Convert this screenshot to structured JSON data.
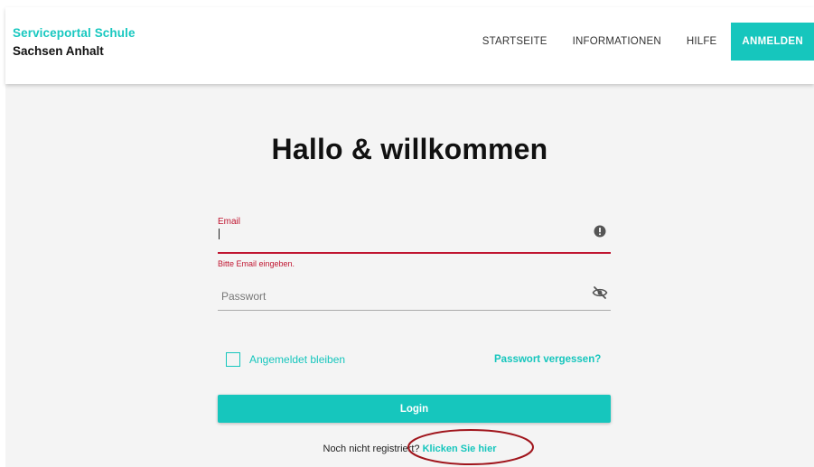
{
  "header": {
    "brand_line1": "Serviceportal Schule",
    "brand_line2": "Sachsen Anhalt",
    "nav": [
      {
        "label": "STARTSEITE"
      },
      {
        "label": "INFORMATIONEN"
      },
      {
        "label": "HILFE"
      }
    ],
    "login_label": "ANMELDEN"
  },
  "main": {
    "title": "Hallo & willkommen",
    "email": {
      "label": "Email",
      "value": "",
      "error": "Bitte Email eingeben.",
      "icon": "alert-circle-icon"
    },
    "password": {
      "placeholder": "Passwort",
      "icon": "eye-off-icon"
    },
    "remember_label": "Angemeldet bleiben",
    "remember_checked": false,
    "forgot_label": "Passwort vergessen?",
    "login_button": "Login",
    "register_prompt": "Noch nicht registriert?",
    "register_link": "Klicken Sie hier"
  },
  "colors": {
    "accent": "#16c6bd",
    "error": "#c01530",
    "annotation": "#a0151c",
    "background": "#f4f4f4"
  }
}
